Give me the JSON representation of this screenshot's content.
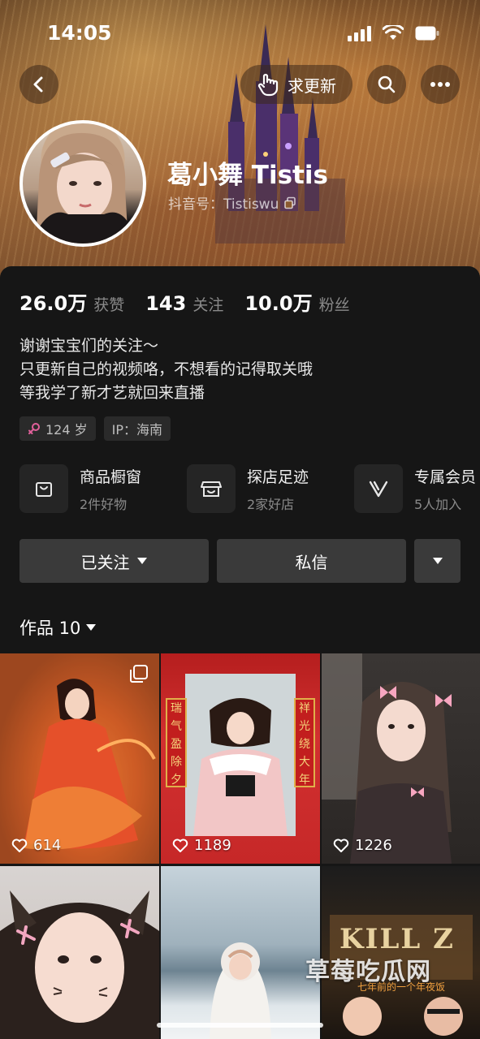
{
  "status_bar": {
    "time": "14:05"
  },
  "header": {
    "request_update_label": "求更新"
  },
  "profile": {
    "nickname": "葛小舞 Tistis",
    "douyin_id": "抖音号：Tistiswu"
  },
  "stats": [
    {
      "value": "26.0万",
      "label": "获赞"
    },
    {
      "value": "143",
      "label": "关注"
    },
    {
      "value": "10.0万",
      "label": "粉丝"
    }
  ],
  "bio": [
    "谢谢宝宝们的关注～",
    "只更新自己的视频咯，不想看的记得取关哦",
    "等我学了新才艺就回来直播"
  ],
  "tags": {
    "age": "124 岁",
    "ip": "IP：海南"
  },
  "features": [
    {
      "title": "商品橱窗",
      "subtitle": "2件好物",
      "icon": "bag-icon"
    },
    {
      "title": "探店足迹",
      "subtitle": "2家好店",
      "icon": "store-icon"
    },
    {
      "title": "专属会员",
      "subtitle": "5人加入",
      "icon": "vip-icon"
    }
  ],
  "actions": {
    "follow_label": "已关注",
    "message_label": "私信"
  },
  "works": {
    "title": "作品 10"
  },
  "videos": [
    {
      "likes": "614"
    },
    {
      "likes": "1189",
      "couplet_left": "瑞气盈除夕",
      "couplet_right": "祥光绕大年"
    },
    {
      "likes": "1226"
    },
    {
      "likes": ""
    },
    {
      "likes": ""
    },
    {
      "likes": "",
      "top_text": "KILL Z",
      "bottom_text": "七年前的一个年夜饭"
    }
  ],
  "watermark": "草莓吃瓜网",
  "colors": {
    "background": "#161616",
    "button": "#3a3a3a",
    "tag_bg": "#2a2a2a",
    "gender_pink": "#e0609a"
  }
}
